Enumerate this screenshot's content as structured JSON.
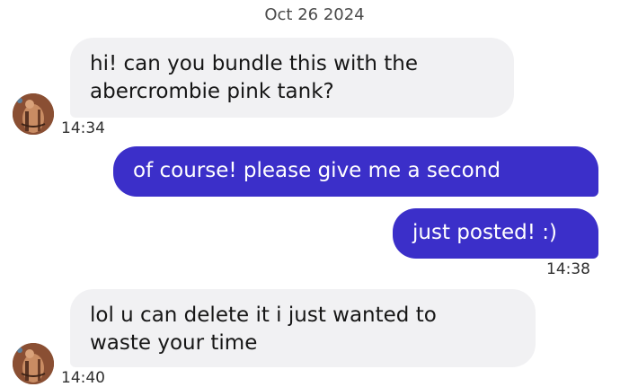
{
  "conversation": {
    "date": "Oct 26 2024",
    "messages": [
      {
        "direction": "incoming",
        "lines": [
          "hi! can you bundle this with the",
          "abercrombie pink tank?"
        ],
        "time": "14:34"
      },
      {
        "direction": "outgoing",
        "lines": [
          "of course! please give me a second"
        ],
        "time": ""
      },
      {
        "direction": "outgoing",
        "lines": [
          "just posted! :)"
        ],
        "time": "14:38"
      },
      {
        "direction": "incoming",
        "lines": [
          "lol u can delete it i just wanted to",
          "waste your time"
        ],
        "time": "14:40"
      }
    ]
  },
  "colors": {
    "outgoing_bubble": "#3b2fc9",
    "incoming_bubble": "#f1f1f3"
  },
  "icons": {
    "contact_avatar": "user-avatar-photo"
  }
}
